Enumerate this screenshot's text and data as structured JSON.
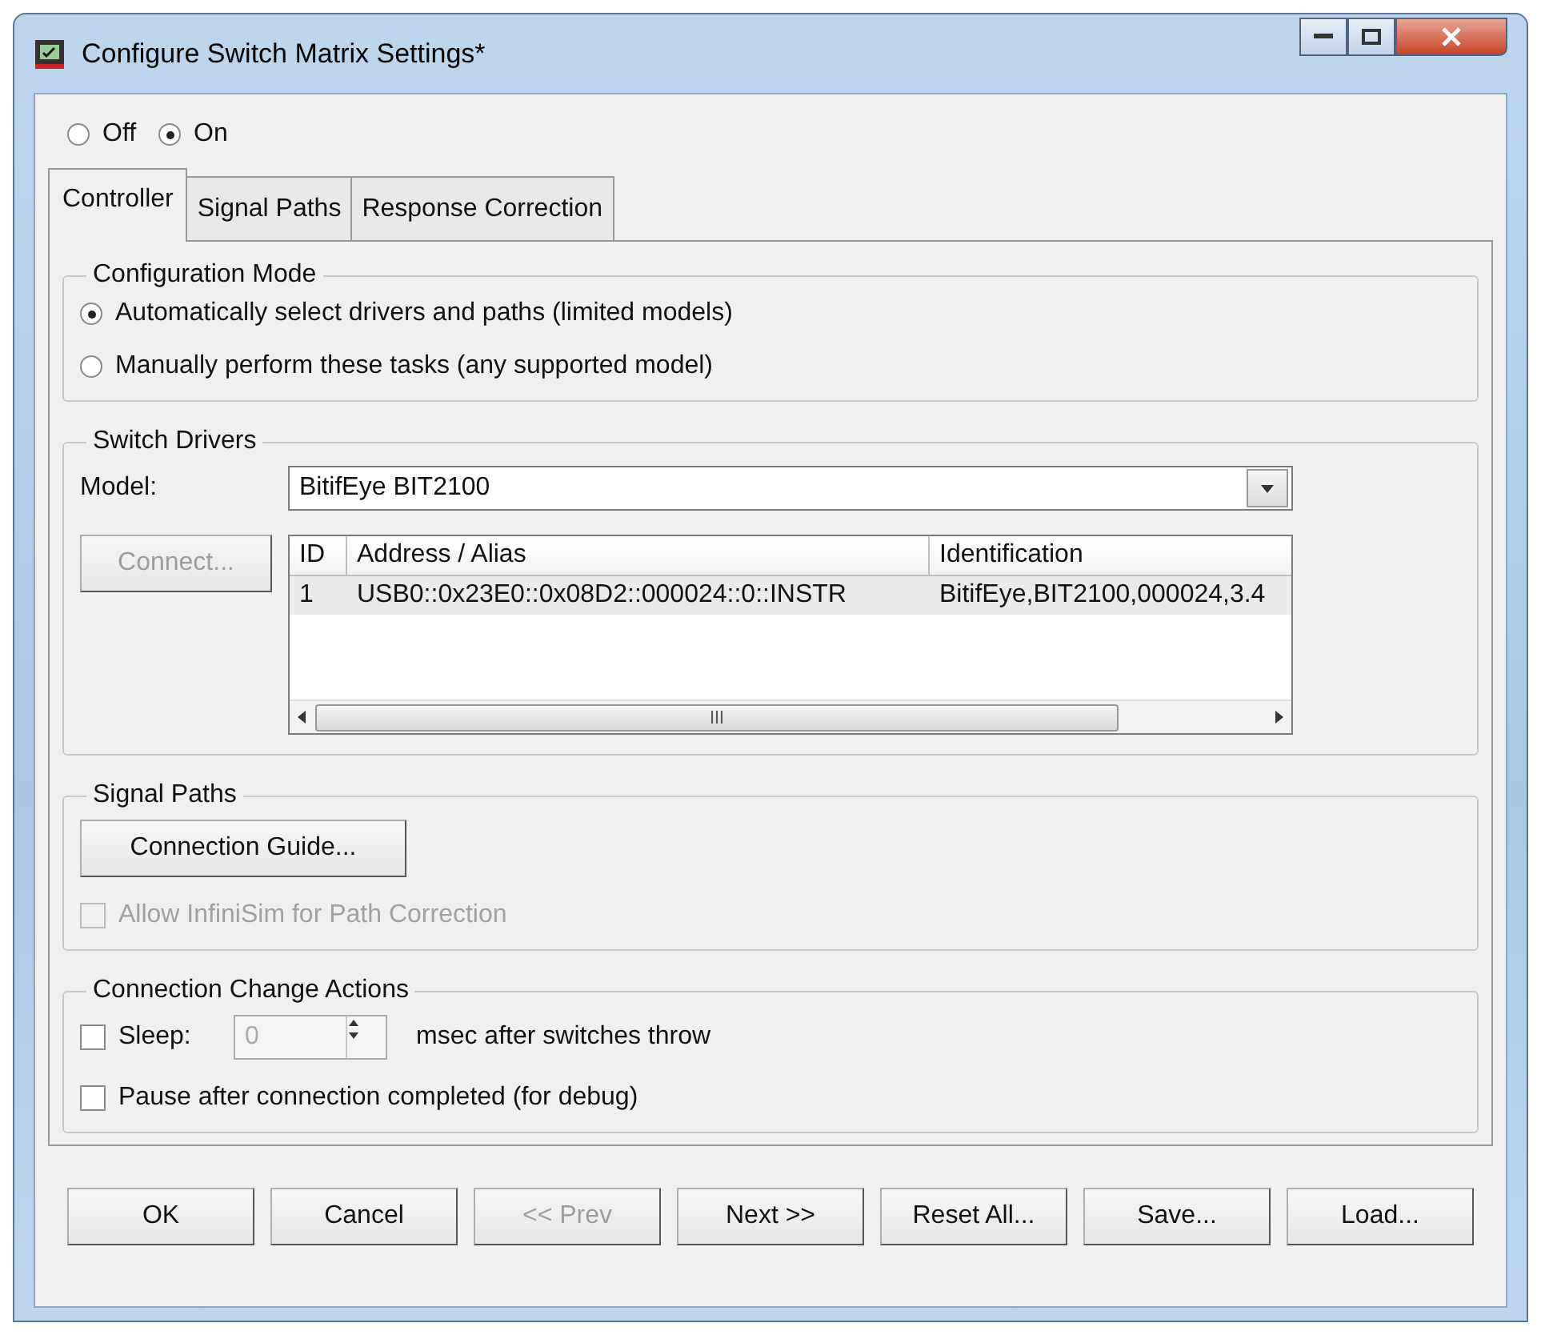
{
  "window": {
    "title": "Configure Switch Matrix Settings*"
  },
  "power_mode": [
    {
      "label": "Off",
      "selected": false
    },
    {
      "label": "On",
      "selected": true
    }
  ],
  "tabs": [
    {
      "label": "Controller",
      "selected": true
    },
    {
      "label": "Signal Paths",
      "selected": false
    },
    {
      "label": "Response Correction",
      "selected": false
    }
  ],
  "configuration_mode": {
    "title": "Configuration Mode",
    "options": [
      {
        "label": "Automatically select drivers and paths (limited models)",
        "selected": true
      },
      {
        "label": "Manually perform these tasks (any supported model)",
        "selected": false
      }
    ]
  },
  "switch_drivers": {
    "title": "Switch Drivers",
    "model_label": "Model:",
    "model_value": "BitifEye BIT2100",
    "connect_button": {
      "label": "Connect...",
      "disabled": true
    },
    "table": {
      "columns": [
        "ID",
        "Address / Alias",
        "Identification"
      ],
      "rows": [
        [
          "1",
          "USB0::0x23E0::0x08D2::000024::0::INSTR",
          "BitifEye,BIT2100,000024,3.4"
        ]
      ]
    }
  },
  "signal_paths": {
    "title": "Signal Paths",
    "guide_button": "Connection Guide...",
    "allow_infinisim": {
      "label": "Allow InfiniSim for Path Correction",
      "checked": false,
      "disabled": true
    }
  },
  "connection_change_actions": {
    "title": "Connection Change Actions",
    "sleep": {
      "label": "Sleep:",
      "checked": false,
      "value": "0",
      "suffix": "msec after switches throw"
    },
    "pause": {
      "label": "Pause after connection completed (for debug)",
      "checked": false
    }
  },
  "buttons": [
    {
      "label": "OK",
      "disabled": false
    },
    {
      "label": "Cancel",
      "disabled": false
    },
    {
      "label": "<< Prev",
      "disabled": true
    },
    {
      "label": "Next >>",
      "disabled": false
    },
    {
      "label": "Reset All...",
      "disabled": false
    },
    {
      "label": "Save...",
      "disabled": false
    },
    {
      "label": "Load...",
      "disabled": false
    }
  ]
}
